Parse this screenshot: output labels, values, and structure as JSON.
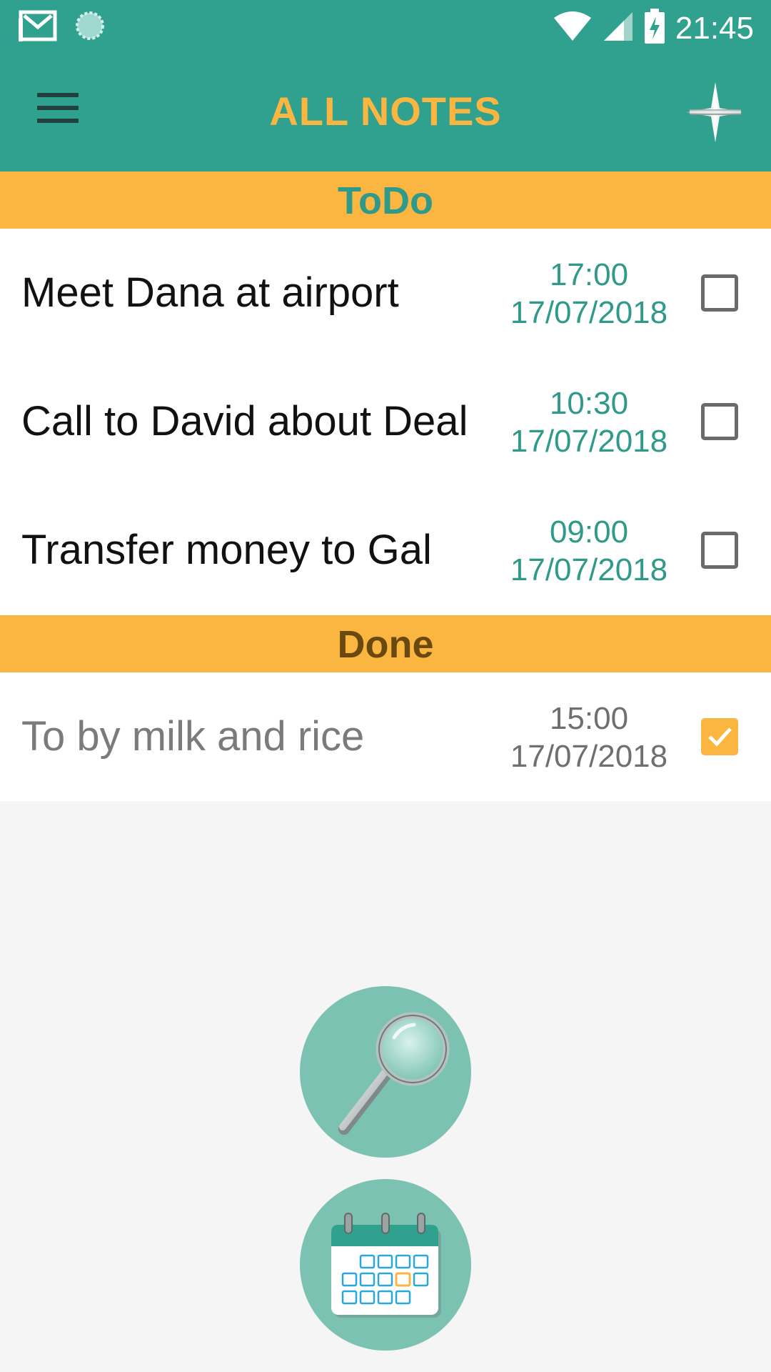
{
  "status_bar": {
    "time": "21:45",
    "icons": [
      "gmail-icon",
      "sync-icon",
      "wifi-icon",
      "signal-icon",
      "battery-charging-icon"
    ]
  },
  "app_bar": {
    "title": "ALL NOTES",
    "menu_icon": "hamburger-menu-icon",
    "add_icon": "plus-icon"
  },
  "sections": {
    "todo": {
      "label": "ToDo",
      "items": [
        {
          "title": "Meet Dana at airport",
          "time": "17:00",
          "date": "17/07/2018",
          "checked": false
        },
        {
          "title": "Call to David about Deal",
          "time": "10:30",
          "date": "17/07/2018",
          "checked": false
        },
        {
          "title": "Transfer money to Gal",
          "time": "09:00",
          "date": "17/07/2018",
          "checked": false
        }
      ]
    },
    "done": {
      "label": "Done",
      "items": [
        {
          "title": "To by milk and rice",
          "time": "15:00",
          "date": "17/07/2018",
          "checked": true
        }
      ]
    }
  },
  "floating_buttons": {
    "search_icon": "magnifier-icon",
    "calendar_icon": "calendar-icon"
  },
  "colors": {
    "primary": "#31a18f",
    "accent": "#fbb541",
    "fab": "#7cc2b2",
    "todo_text": "#2f9a89",
    "done_header_text": "#6a4810"
  }
}
